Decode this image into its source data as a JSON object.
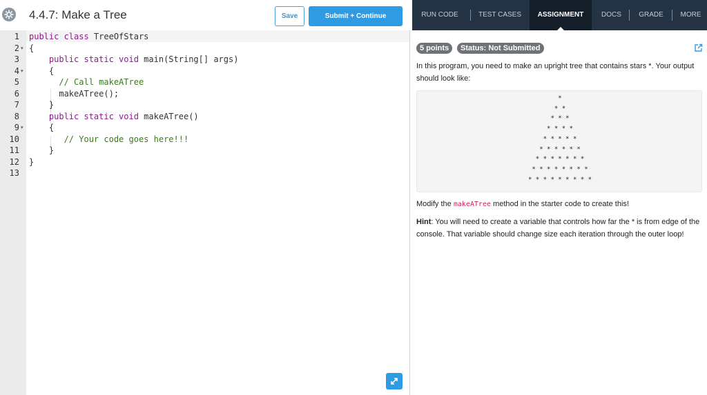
{
  "header": {
    "title": "4.4.7: Make a Tree",
    "save_label": "Save",
    "submit_label": "Submit + Continue"
  },
  "editor": {
    "line_numbers": [
      "1",
      "2",
      "3",
      "4",
      "5",
      "6",
      "7",
      "8",
      "9",
      "10",
      "11",
      "12",
      "13"
    ],
    "folds": [
      "",
      "▾",
      "",
      "▾",
      "",
      "",
      "",
      "",
      "▾",
      "",
      "",
      "",
      ""
    ],
    "lines": [
      [
        {
          "t": "public class",
          "c": "kw"
        },
        {
          "t": " TreeOfStars",
          "c": ""
        }
      ],
      [
        {
          "t": "{",
          "c": ""
        }
      ],
      [
        {
          "t": "    public static void",
          "c": "kw"
        },
        {
          "t": " main(String[] args)",
          "c": ""
        }
      ],
      [
        {
          "t": "    {",
          "c": ""
        }
      ],
      [
        {
          "t": "      // Call makeATree",
          "c": "cm"
        }
      ],
      [
        {
          "t": "      makeATree();",
          "c": ""
        }
      ],
      [
        {
          "t": "    }",
          "c": ""
        }
      ],
      [
        {
          "t": "    public static void",
          "c": "kw"
        },
        {
          "t": " makeATree()",
          "c": ""
        }
      ],
      [
        {
          "t": "    {",
          "c": ""
        }
      ],
      [
        {
          "t": "       // Your code goes here!!!",
          "c": "cm"
        }
      ],
      [
        {
          "t": "    }",
          "c": ""
        }
      ],
      [
        {
          "t": "}",
          "c": ""
        }
      ],
      [
        {
          "t": "",
          "c": ""
        }
      ]
    ]
  },
  "tabs": [
    {
      "label": "RUN CODE",
      "active": false
    },
    {
      "label": "TEST CASES",
      "active": false
    },
    {
      "label": "ASSIGNMENT",
      "active": true
    },
    {
      "label": "DOCS",
      "active": false
    },
    {
      "label": "GRADE",
      "active": false
    },
    {
      "label": "MORE",
      "active": false
    }
  ],
  "assignment": {
    "points_badge": "5 points",
    "status_badge": "Status: Not Submitted",
    "intro": "In this program, you need to make an upright tree that contains stars *. Your output should look like:",
    "tree_output": [
      "*",
      "* *",
      "* * *",
      "* * * *",
      "* * * * *",
      "* * * * * *",
      "* * * * * * *",
      "* * * * * * * *",
      "* * * * * * * * *"
    ],
    "modify_prefix": "Modify the ",
    "modify_code": "makeATree",
    "modify_suffix": " method in the starter code to create this!",
    "hint_label": "Hint",
    "hint_text": ": You will need to create a variable that controls how far the * is from edge of the console. That variable should change size each iteration through the outer loop!"
  },
  "colors": {
    "primary_blue": "#2f9be2",
    "tabbar_bg": "#243444",
    "tab_active_bg": "#141e28",
    "keyword": "#8c1a8c",
    "comment": "#3a7a1a"
  }
}
